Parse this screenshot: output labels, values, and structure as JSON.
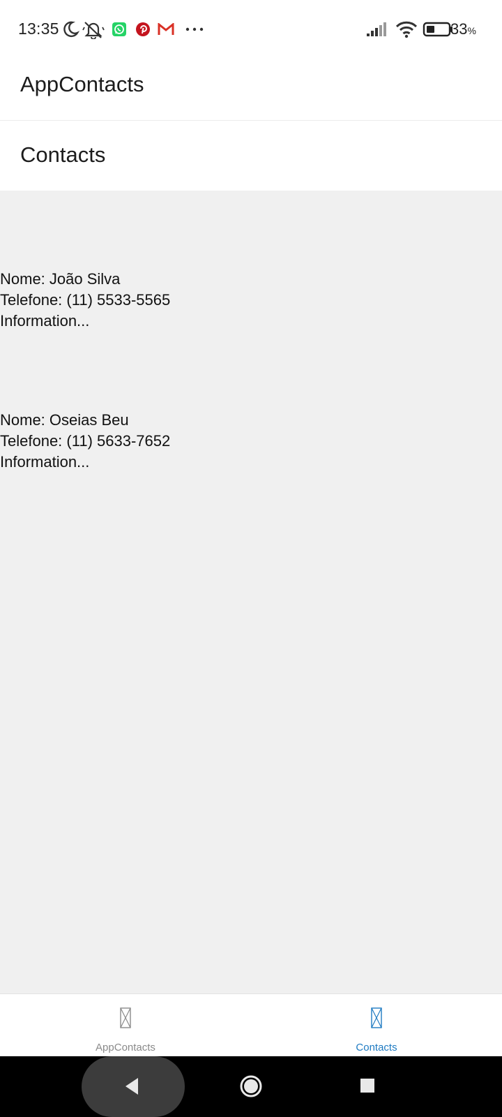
{
  "status_bar": {
    "time": "13:35",
    "battery_percent": "33",
    "battery_suffix": "%",
    "icons": [
      "moon-icon",
      "notifications-off-icon",
      "whatsapp-icon",
      "pinterest-icon",
      "gmail-icon",
      "more-icon",
      "signal-icon",
      "wifi-icon",
      "battery-icon"
    ]
  },
  "header": {
    "app_title": "AppContacts",
    "page_title": "Contacts"
  },
  "contacts": [
    {
      "name": "Nome: João Silva",
      "phone": "Telefone: (11) 5533-5565",
      "info": "Information..."
    },
    {
      "name": "Nome: Oseias Beu",
      "phone": "Telefone: (11) 5633-7652",
      "info": "Information..."
    }
  ],
  "tabs": [
    {
      "label": "AppContacts",
      "icon": "missing-glyph-icon",
      "active": false
    },
    {
      "label": "Contacts",
      "icon": "missing-glyph-icon",
      "active": true
    }
  ],
  "colors": {
    "active_tab": "#1f7bc2",
    "inactive_tab": "#8a8a8a",
    "content_background": "#f0f0f0",
    "whatsapp": "#25d366",
    "pinterest": "#c4141e",
    "gmail": "#d93025"
  },
  "nav_bar": {
    "buttons": [
      "back-icon",
      "home-icon",
      "recents-icon"
    ]
  }
}
